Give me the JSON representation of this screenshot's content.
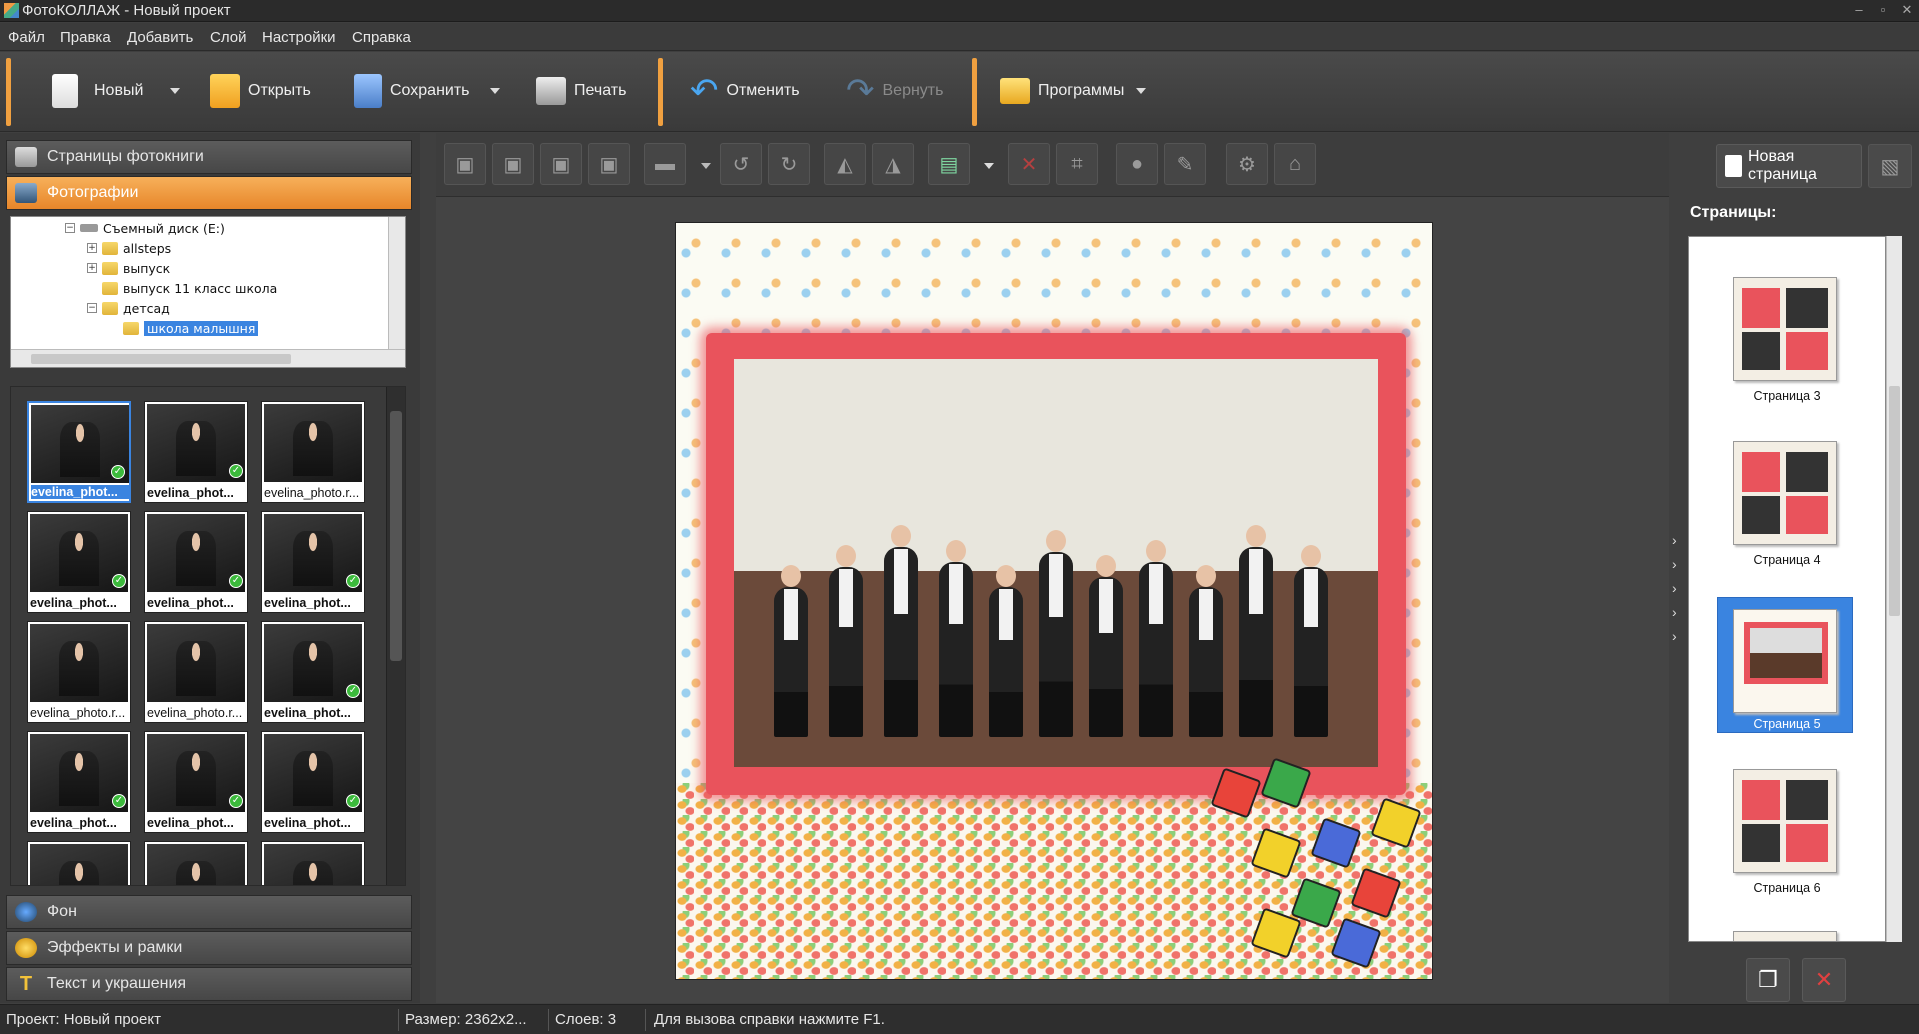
{
  "window": {
    "title": "ФотоКОЛЛАЖ - Новый проект"
  },
  "menu": [
    "Файл",
    "Правка",
    "Добавить",
    "Слой",
    "Настройки",
    "Справка"
  ],
  "toolbar": {
    "new": "Новый",
    "open": "Открыть",
    "save": "Сохранить",
    "print": "Печать",
    "undo": "Отменить",
    "redo": "Вернуть",
    "programs": "Программы"
  },
  "left_panel": {
    "photobook_pages": "Страницы фотокниги",
    "photos": "Фотографии",
    "background": "Фон",
    "effects": "Эффекты и рамки",
    "text": "Текст и украшения"
  },
  "tree": {
    "drive": "Съемный диск (E:)",
    "items": [
      "allsteps",
      "выпуск",
      "выпуск 11 класс школа",
      "детсад",
      "школа малышня"
    ]
  },
  "thumbnails": [
    "evelina_phot...",
    "evelina_phot...",
    "evelina_photo.r...",
    "evelina_phot...",
    "evelina_phot...",
    "evelina_phot...",
    "evelina_photo.r...",
    "evelina_photo.r...",
    "evelina_phot...",
    "evelina_phot...",
    "evelina_phot...",
    "evelina_phot..."
  ],
  "editor": {
    "new_page": "Новая страница"
  },
  "pages_panel": {
    "title": "Страницы:",
    "pages": [
      "Страница 3",
      "Страница 4",
      "Страница 5",
      "Страница 6"
    ],
    "selected": "Страница 5"
  },
  "status": {
    "project": "Проект:  Новый проект",
    "size": "Размер:  2362x2...",
    "layers": "Слоев:  3",
    "help": "Для вызова справки нажмите F1."
  },
  "colors": {
    "accent": "#f0a040",
    "selection": "#3a84e0",
    "frame": "#e9535c"
  }
}
